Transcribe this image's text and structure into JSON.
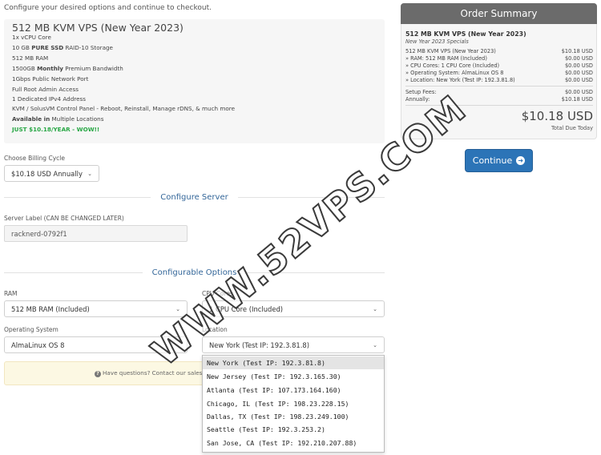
{
  "intro": "Configure your desired options and continue to checkout.",
  "product": {
    "title": "512 MB KVM VPS (New Year 2023)",
    "features": [
      {
        "pre": "1x vCPU Core",
        "bold": "",
        "post": ""
      },
      {
        "pre": "10 GB ",
        "bold": "PURE SSD",
        "post": " RAID-10 Storage"
      },
      {
        "pre": "512 MB RAM",
        "bold": "",
        "post": ""
      },
      {
        "pre": "1500GB ",
        "bold": "Monthly",
        "post": " Premium Bandwidth"
      },
      {
        "pre": "1Gbps Public Network Port",
        "bold": "",
        "post": ""
      },
      {
        "pre": "Full Root Admin Access",
        "bold": "",
        "post": ""
      },
      {
        "pre": "1 Dedicated IPv4 Address",
        "bold": "",
        "post": ""
      },
      {
        "pre": "KVM / SolusVM Control Panel - Reboot, Reinstall, Manage rDNS, & much more",
        "bold": "",
        "post": ""
      },
      {
        "pre": "",
        "bold": "Available in",
        "post": " Multiple Locations"
      }
    ],
    "promo": "JUST $10.18/YEAR - WOW!!"
  },
  "billing": {
    "label": "Choose Billing Cycle",
    "value": "$10.18 USD Annually"
  },
  "configure_server": {
    "heading": "Configure Server",
    "server_label_label": "Server Label (CAN BE CHANGED LATER)",
    "server_label_value": "racknerd-0792f1"
  },
  "configurable_options": {
    "heading": "Configurable Options",
    "ram_label": "RAM",
    "ram_value": "512 MB RAM (Included)",
    "cpu_label": "CPU Cores",
    "cpu_value": "1 CPU Core (Included)",
    "os_label": "Operating System",
    "os_value": "AlmaLinux OS 8",
    "location_label": "Location",
    "location_value": "New York (Test IP: 192.3.81.8)"
  },
  "help": {
    "text": "Have questions? Contact our sales"
  },
  "location_options": [
    "New York (Test IP: 192.3.81.8)",
    "New Jersey (Test IP: 192.3.165.30)",
    "Atlanta (Test IP: 107.173.164.160)",
    "Chicago, IL (Test IP: 198.23.228.15)",
    "Dallas, TX (Test IP: 198.23.249.100)",
    "Seattle (Test IP: 192.3.253.2)",
    "San Jose, CA (Test IP: 192.210.207.88)"
  ],
  "order_summary": {
    "heading": "Order Summary",
    "title": "512 MB KVM VPS (New Year 2023)",
    "subtitle": "New Year 2023 Specials",
    "lines": [
      {
        "label": "512 MB KVM VPS (New Year 2023)",
        "amount": "$10.18 USD"
      },
      {
        "label": "» RAM: 512 MB RAM (Included)",
        "amount": "$0.00 USD"
      },
      {
        "label": "» CPU Cores: 1 CPU Core (Included)",
        "amount": "$0.00 USD"
      },
      {
        "label": "» Operating System: AlmaLinux OS 8",
        "amount": "$0.00 USD"
      },
      {
        "label": "» Location: New York (Test IP: 192.3.81.8)",
        "amount": "$0.00 USD"
      }
    ],
    "fees": [
      {
        "label": "Setup Fees:",
        "amount": "$0.00 USD"
      },
      {
        "label": "Annually:",
        "amount": "$10.18 USD"
      }
    ],
    "total": "$10.18 USD",
    "total_label": "Total Due Today"
  },
  "continue_label": "Continue",
  "watermark": "WWW.52VPS.COM",
  "icons": {
    "help": "question-circle-icon",
    "continue": "arrow-circle-right-icon",
    "dropdown": "chevron-down-icon"
  }
}
